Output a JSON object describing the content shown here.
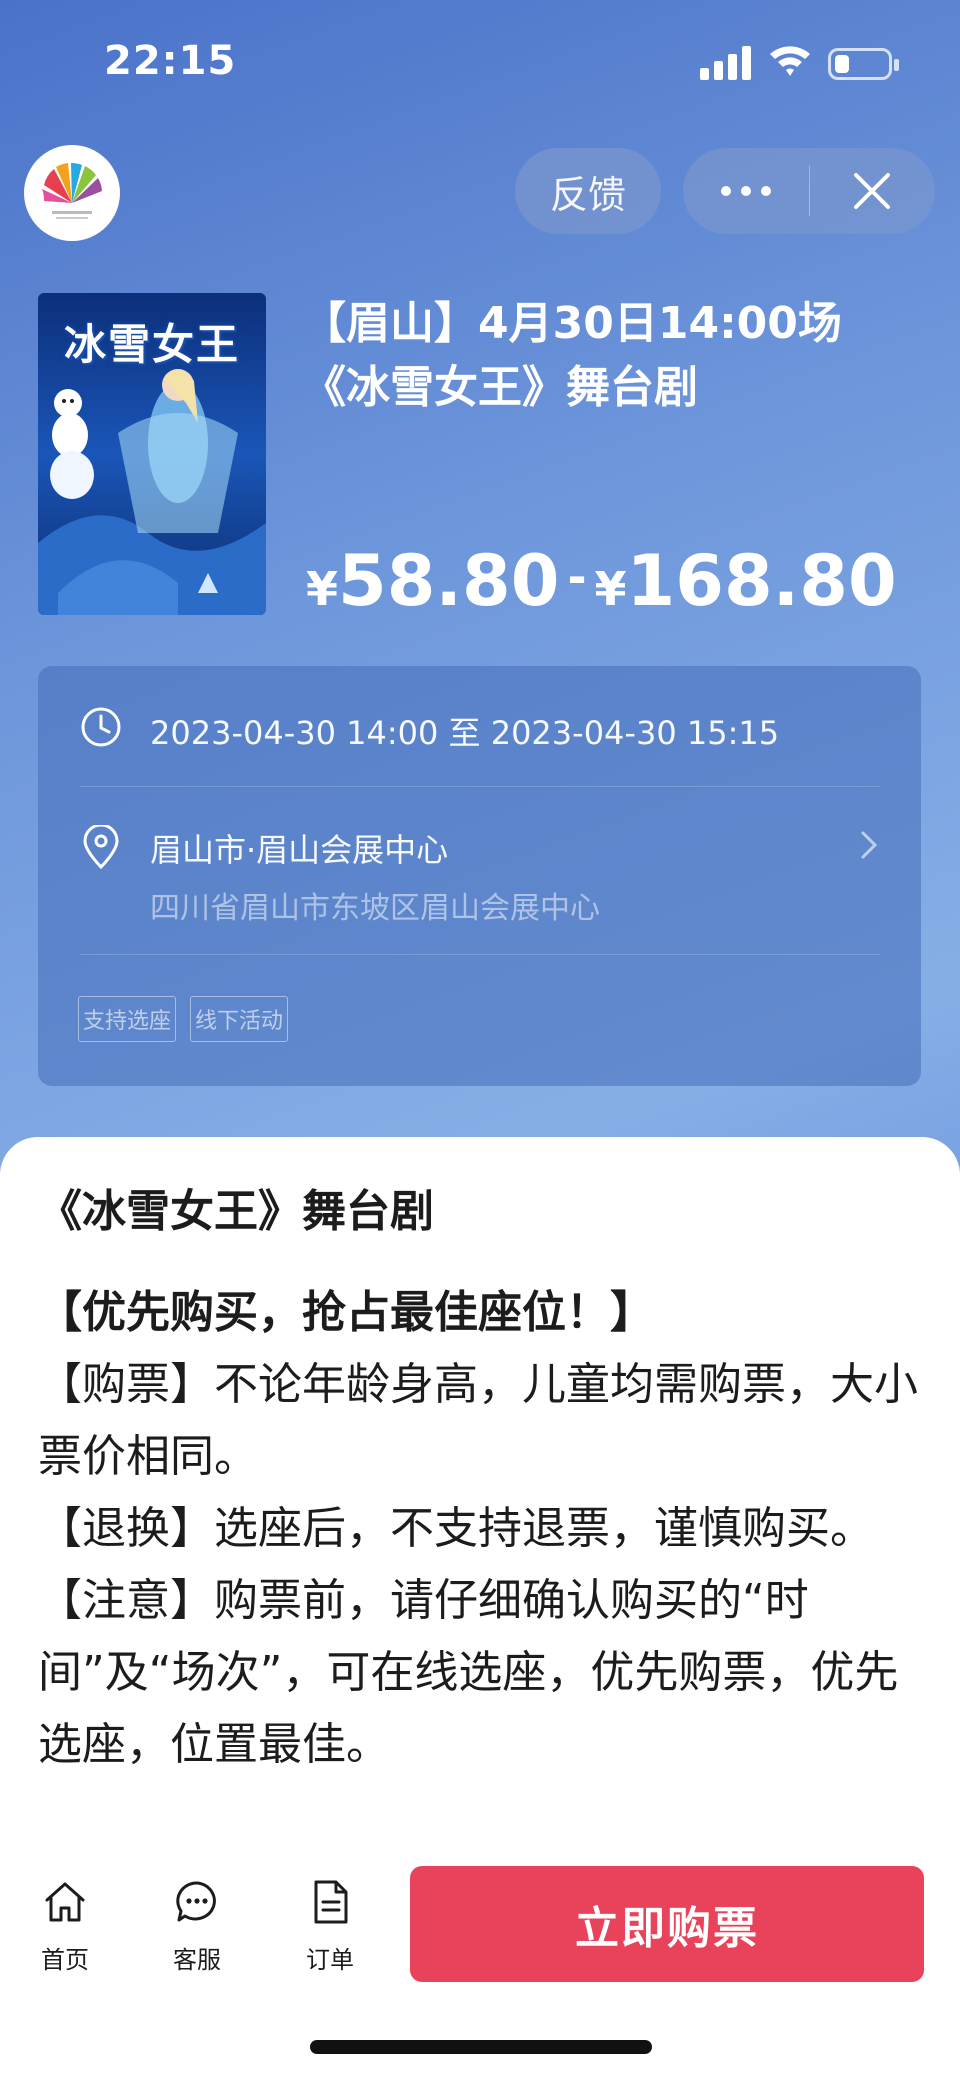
{
  "status_bar": {
    "time": "22:15"
  },
  "top_nav": {
    "logo_icon": "peacock-fan-logo",
    "feedback_label": "反馈",
    "more_icon": "ellipsis-icon",
    "close_icon": "close-icon"
  },
  "product": {
    "poster_title": "冰雪女王",
    "title": "【眉山】4月30日14:00场《冰雪女王》舞台剧",
    "price_symbol": "¥",
    "price_min": "58.80",
    "price_sep": "-",
    "price_max": "168.80"
  },
  "info": {
    "time_range": "2023-04-30 14:00 至 2023-04-30 15:15",
    "venue_name": "眉山市·眉山会展中心",
    "venue_address": "四川省眉山市东坡区眉山会展中心",
    "tags": [
      "支持选座",
      "线下活动"
    ]
  },
  "sheet": {
    "title": "《冰雪女王》舞台剧",
    "headline": "【优先购买，抢占最佳座位！】",
    "paragraphs": [
      "【购票】不论年龄身高，儿童均需购票，大小票价相同。",
      "【退换】选座后，不支持退票，谨慎购买。",
      "【注意】购票前，请仔细确认购买的“时间”及“场次”，可在线选座，优先购票，优先选座，位置最佳。"
    ]
  },
  "bottom_nav": {
    "items": [
      {
        "label": "首页",
        "icon": "home-icon"
      },
      {
        "label": "客服",
        "icon": "chat-icon"
      },
      {
        "label": "订单",
        "icon": "document-icon"
      }
    ],
    "buy_label": "立即购票"
  },
  "colors": {
    "accent": "#e8435a"
  }
}
